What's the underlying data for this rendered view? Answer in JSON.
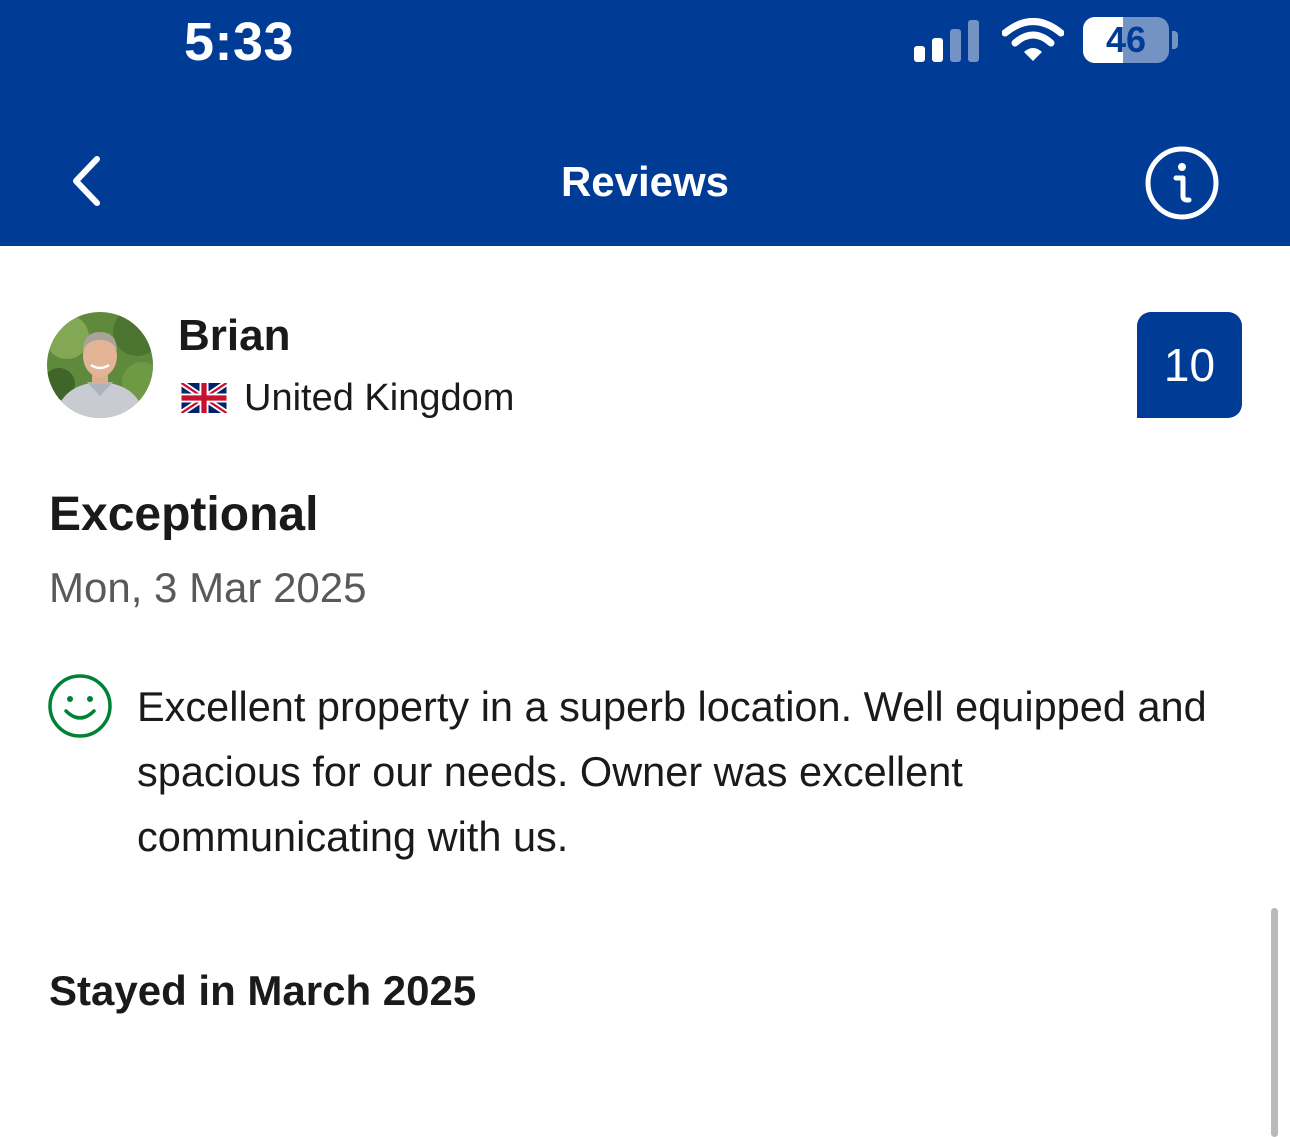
{
  "status_bar": {
    "time": "5:33",
    "battery": "46",
    "battery_level": 0.46
  },
  "nav": {
    "title": "Reviews",
    "back_icon": "chevron-left-icon",
    "info_icon": "info-circle-icon"
  },
  "review": {
    "reviewer_name": "Brian",
    "country": "United Kingdom",
    "flag_icon": "uk-flag-icon",
    "score": "10",
    "rating_word": "Exceptional",
    "date": "Mon, 3 Mar 2025",
    "sentiment_icon": "smile-icon",
    "positive_text": "Excellent property in a superb location. Well equipped and spacious for our needs. Owner was excellent communicating with us.",
    "stayed": "Stayed in March 2025"
  },
  "colors": {
    "brand": "#003b95",
    "positive": "#008234"
  }
}
